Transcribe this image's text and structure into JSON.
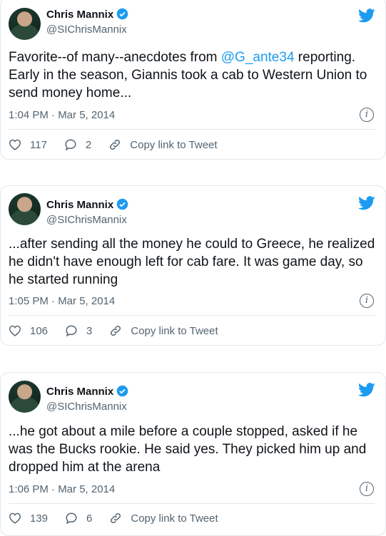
{
  "tweets": [
    {
      "name": "Chris Mannix",
      "handle": "@SIChrisMannix",
      "text_before": "Favorite--of many--anecdotes from ",
      "mention": "@G_ante34",
      "text_after": " reporting. Early in the season, Giannis took a cab to Western Union to send money home...",
      "time": "1:04 PM · Mar 5, 2014",
      "likes": "117",
      "replies": "2",
      "copy_label": "Copy link to Tweet"
    },
    {
      "name": "Chris Mannix",
      "handle": "@SIChrisMannix",
      "text_before": "...after sending all the money he could to Greece, he realized he didn't have enough left for cab fare. It was game day, so he started running",
      "mention": "",
      "text_after": "",
      "time": "1:05 PM · Mar 5, 2014",
      "likes": "106",
      "replies": "3",
      "copy_label": "Copy link to Tweet"
    },
    {
      "name": "Chris Mannix",
      "handle": "@SIChrisMannix",
      "text_before": "...he got about a mile before a couple stopped, asked if he was the Bucks rookie. He said yes. They picked him up and dropped him at the arena",
      "mention": "",
      "text_after": "",
      "time": "1:06 PM · Mar 5, 2014",
      "likes": "139",
      "replies": "6",
      "copy_label": "Copy link to Tweet"
    }
  ],
  "colors": {
    "accent": "#1d9bf0",
    "muted": "#536471",
    "border": "#e1e8ed"
  }
}
